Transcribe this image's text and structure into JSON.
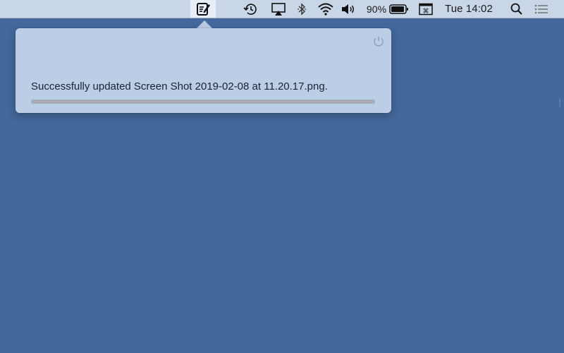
{
  "menubar": {
    "battery_percent": "90%",
    "clock": "Tue 14:02",
    "icons": [
      "notepad-edit-icon",
      "time-machine-icon",
      "airplay-icon",
      "bluetooth-icon",
      "wifi-icon",
      "volume-icon",
      "battery-icon",
      "keyboard-input-icon",
      "spotlight-icon",
      "notification-center-icon"
    ]
  },
  "popover": {
    "message": "Successfully updated Screen Shot 2019-02-08 at 11.20.17.png.",
    "progress": 1.0,
    "power_icon": "power-icon"
  }
}
